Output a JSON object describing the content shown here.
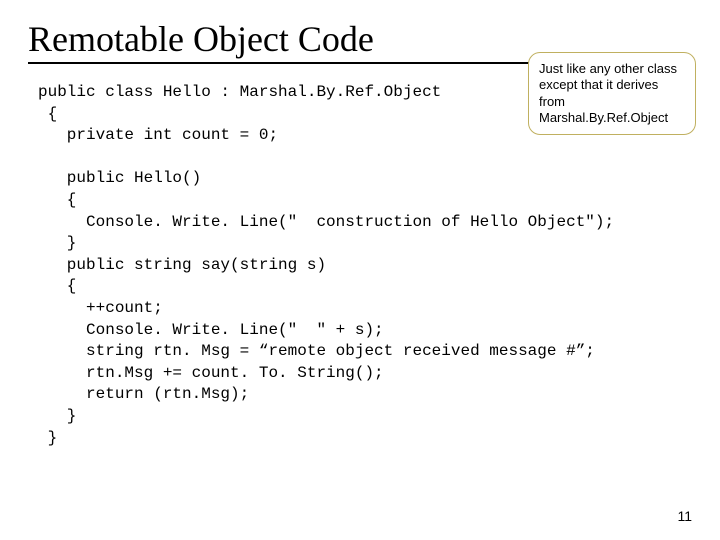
{
  "slide": {
    "title": "Remotable Object Code",
    "page_number": "11"
  },
  "callout": {
    "text": "Just like any other class except that it derives from Marshal.By.Ref.Object"
  },
  "code": {
    "line01": "public class Hello : Marshal.By.Ref.Object",
    "line02": " {",
    "line03": "   private int count = 0;",
    "line04": "",
    "line05": "   public Hello()",
    "line06": "   {",
    "line07": "     Console. Write. Line(\"  construction of Hello Object\");",
    "line08": "   }",
    "line09": "   public string say(string s)",
    "line10": "   {",
    "line11": "     ++count;",
    "line12": "     Console. Write. Line(\"  \" + s);",
    "line13": "     string rtn. Msg = “remote object received message #”;",
    "line14": "     rtn.Msg += count. To. String();",
    "line15": "     return (rtn.Msg);",
    "line16": "   }",
    "line17": " }"
  }
}
